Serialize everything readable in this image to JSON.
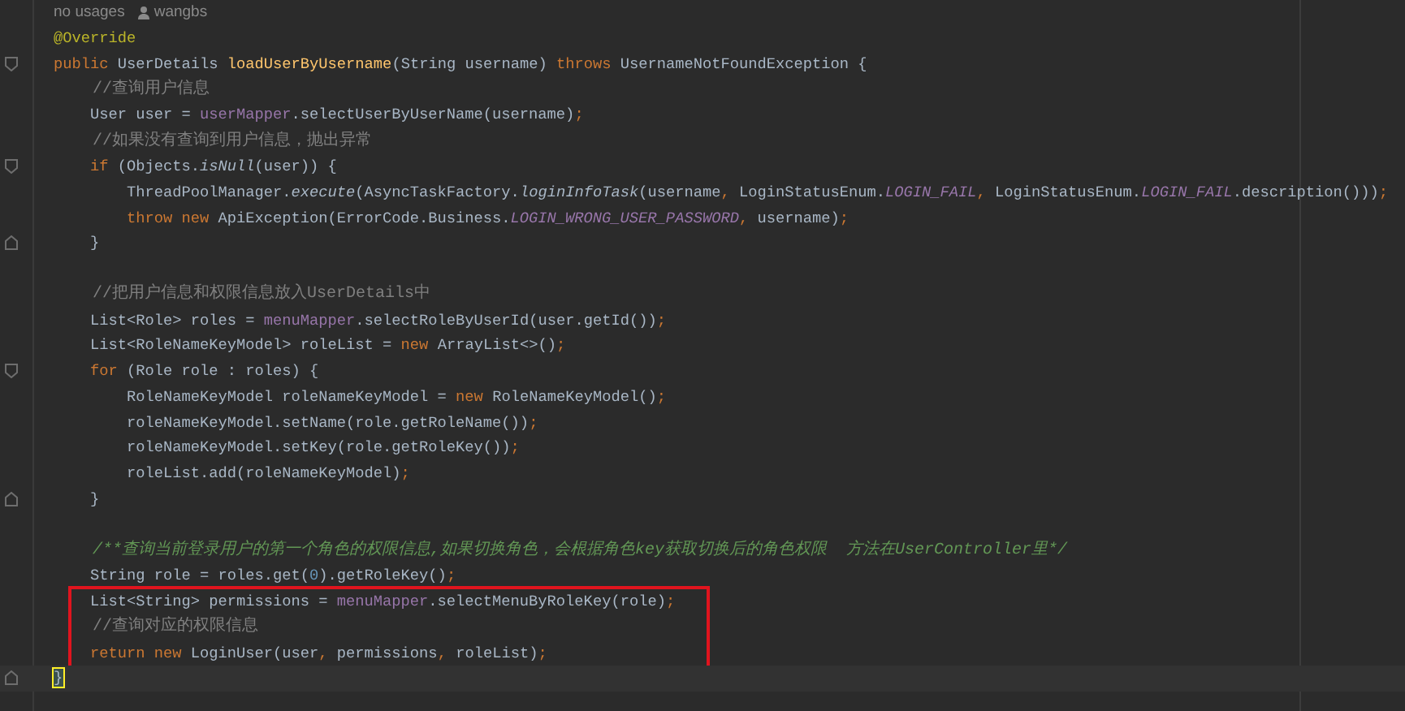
{
  "hints": {
    "usages": "no usages",
    "author": "wangbs"
  },
  "lines": [
    {
      "tokens": [
        {
          "text": "@Override",
          "kind": "ann"
        }
      ]
    },
    {
      "fold_start": true,
      "tokens": [
        {
          "text": "public",
          "kind": "kw"
        },
        {
          "text": " UserDetails ",
          "kind": "plain"
        },
        {
          "text": "loadUserByUsername",
          "kind": "fn"
        },
        {
          "text": "(String username) ",
          "kind": "plain"
        },
        {
          "text": "throws",
          "kind": "kw"
        },
        {
          "text": " UsernameNotFoundException {",
          "kind": "plain"
        }
      ]
    },
    {
      "tokens": [
        {
          "text": "    //查询用户信息",
          "kind": "comment"
        }
      ]
    },
    {
      "tokens": [
        {
          "text": "    User user = ",
          "kind": "plain"
        },
        {
          "text": "userMapper",
          "kind": "field"
        },
        {
          "text": ".selectUserByUserName(username)",
          "kind": "plain"
        },
        {
          "text": ";",
          "kind": "kw"
        }
      ]
    },
    {
      "tokens": [
        {
          "text": "    //如果没有查询到用户信息，抛出异常",
          "kind": "comment"
        }
      ]
    },
    {
      "fold_start": true,
      "tokens": [
        {
          "text": "    if",
          "kind": "kw"
        },
        {
          "text": " (Objects.",
          "kind": "plain"
        },
        {
          "text": "isNull",
          "kind": "italic"
        },
        {
          "text": "(user)) {",
          "kind": "plain"
        }
      ]
    },
    {
      "tokens": [
        {
          "text": "        ThreadPoolManager.",
          "kind": "plain"
        },
        {
          "text": "execute",
          "kind": "italic"
        },
        {
          "text": "(AsyncTaskFactory.",
          "kind": "plain"
        },
        {
          "text": "loginInfoTask",
          "kind": "italic"
        },
        {
          "text": "(username",
          "kind": "plain"
        },
        {
          "text": ", ",
          "kind": "kw"
        },
        {
          "text": "LoginStatusEnum.",
          "kind": "plain"
        },
        {
          "text": "LOGIN_FAIL",
          "kind": "static"
        },
        {
          "text": ", ",
          "kind": "kw"
        },
        {
          "text": "LoginStatusEnum.",
          "kind": "plain"
        },
        {
          "text": "LOGIN_FAIL",
          "kind": "static"
        },
        {
          "text": ".description()))",
          "kind": "plain"
        },
        {
          "text": ";",
          "kind": "kw"
        }
      ]
    },
    {
      "tokens": [
        {
          "text": "        throw new",
          "kind": "kw"
        },
        {
          "text": " ApiException(ErrorCode.Business.",
          "kind": "plain"
        },
        {
          "text": "LOGIN_WRONG_USER_PASSWORD",
          "kind": "static"
        },
        {
          "text": ", ",
          "kind": "kw"
        },
        {
          "text": "username)",
          "kind": "plain"
        },
        {
          "text": ";",
          "kind": "kw"
        }
      ]
    },
    {
      "fold_end": true,
      "tokens": [
        {
          "text": "    }",
          "kind": "plain"
        }
      ]
    },
    {
      "space_before": true,
      "tokens": [
        {
          "text": "    //把用户信息和权限信息放入UserDetails中",
          "kind": "comment"
        }
      ]
    },
    {
      "tokens": [
        {
          "text": "    List<Role> roles = ",
          "kind": "plain"
        },
        {
          "text": "menuMapper",
          "kind": "field"
        },
        {
          "text": ".selectRoleByUserId(user.getId())",
          "kind": "plain"
        },
        {
          "text": ";",
          "kind": "kw"
        }
      ]
    },
    {
      "tokens": [
        {
          "text": "    List<RoleNameKeyModel> roleList = ",
          "kind": "plain"
        },
        {
          "text": "new",
          "kind": "kw"
        },
        {
          "text": " ArrayList<>()",
          "kind": "plain"
        },
        {
          "text": ";",
          "kind": "kw"
        }
      ]
    },
    {
      "fold_start": true,
      "tokens": [
        {
          "text": "    for",
          "kind": "kw"
        },
        {
          "text": " (Role role : roles) {",
          "kind": "plain"
        }
      ]
    },
    {
      "tokens": [
        {
          "text": "        RoleNameKeyModel roleNameKeyModel = ",
          "kind": "plain"
        },
        {
          "text": "new",
          "kind": "kw"
        },
        {
          "text": " RoleNameKeyModel()",
          "kind": "plain"
        },
        {
          "text": ";",
          "kind": "kw"
        }
      ]
    },
    {
      "tokens": [
        {
          "text": "        roleNameKeyModel.setName(role.getRoleName())",
          "kind": "plain"
        },
        {
          "text": ";",
          "kind": "kw"
        }
      ]
    },
    {
      "tokens": [
        {
          "text": "        roleNameKeyModel.setKey(role.getRoleKey())",
          "kind": "plain"
        },
        {
          "text": ";",
          "kind": "kw"
        }
      ]
    },
    {
      "tokens": [
        {
          "text": "        roleList.add(roleNameKeyModel)",
          "kind": "plain"
        },
        {
          "text": ";",
          "kind": "kw"
        }
      ]
    },
    {
      "fold_end": true,
      "tokens": [
        {
          "text": "    }",
          "kind": "plain"
        }
      ]
    },
    {
      "space_before": true,
      "tokens": [
        {
          "text": "    /**查询当前登录用户的第一个角色的权限信息,如果切换角色，会根据角色key获取切换后的角色权限  方法在UserController里*/",
          "kind": "doc"
        }
      ]
    },
    {
      "tokens": [
        {
          "text": "    String role = roles.get(",
          "kind": "plain"
        },
        {
          "text": "0",
          "kind": "num"
        },
        {
          "text": ").getRoleKey()",
          "kind": "plain"
        },
        {
          "text": ";",
          "kind": "kw"
        }
      ]
    },
    {
      "boxed": true,
      "tokens": [
        {
          "text": "    List<String> permissions = ",
          "kind": "plain"
        },
        {
          "text": "menuMapper",
          "kind": "field"
        },
        {
          "text": ".selectMenuByRoleKey(role)",
          "kind": "plain"
        },
        {
          "text": ";",
          "kind": "kw"
        }
      ]
    },
    {
      "boxed": true,
      "tokens": [
        {
          "text": "    //查询对应的权限信息",
          "kind": "comment"
        }
      ]
    },
    {
      "boxed": true,
      "tokens": [
        {
          "text": "    return new",
          "kind": "kw"
        },
        {
          "text": " LoginUser(user",
          "kind": "plain"
        },
        {
          "text": ", ",
          "kind": "kw"
        },
        {
          "text": "permissions",
          "kind": "plain"
        },
        {
          "text": ", ",
          "kind": "kw"
        },
        {
          "text": "roleList)",
          "kind": "plain"
        },
        {
          "text": ";",
          "kind": "kw"
        }
      ]
    },
    {
      "fold_end": true,
      "current": true,
      "tokens": [
        {
          "text": "}",
          "kind": "match"
        }
      ]
    }
  ]
}
